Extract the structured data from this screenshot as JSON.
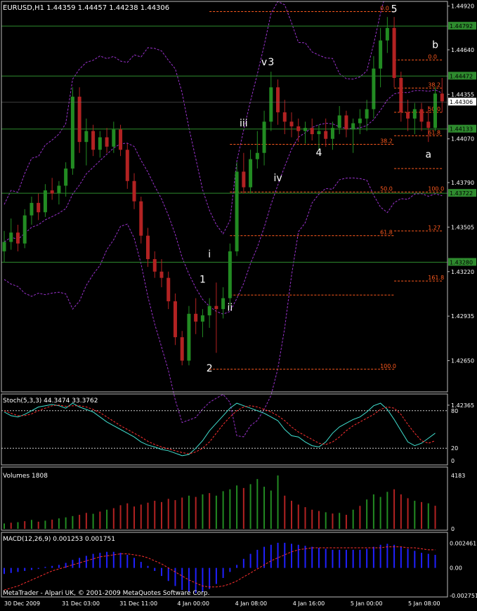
{
  "chart_data": {
    "type": "candlestick",
    "symbol_header": "EURUSD,H1  1.44359 1.44457 1.44238 1.44306",
    "footer": "MetaTrader - Alpari UK, © 2001-2009 MetaQuotes Software Corp.",
    "colors": {
      "background": "#000000",
      "bull": "#228b22",
      "bear": "#b22222",
      "bands": "#9932cc",
      "levels": "#ff5a1e",
      "hlines": "#2e8b2e",
      "axis_text": "#ffffff",
      "stoch_main": "#40e0d0",
      "stoch_signal": "#ff3030",
      "macd_hist": "#2020ff",
      "macd_signal": "#ff3030"
    },
    "time_labels": [
      "30 Dec 2009",
      "31 Dec 03:00",
      "31 Dec 11:00",
      "4 Jan 00:00",
      "4 Jan 08:00",
      "4 Jan 16:00",
      "5 Jan 00:00",
      "5 Jan 08:00"
    ],
    "main": {
      "ylim": [
        1.4245,
        1.4495
      ],
      "price_ticks": [
        "1.44920",
        "1.44640",
        "1.44355",
        "1.44070",
        "1.43790",
        "1.43505",
        "1.43220",
        "1.42935",
        "1.42650",
        "1.42365"
      ],
      "tick_values": [
        1.4492,
        1.4464,
        1.44355,
        1.4407,
        1.4379,
        1.43505,
        1.4322,
        1.42935,
        1.4265,
        1.42365
      ],
      "tick_labels": [
        "1.44920",
        "1.44640",
        "1.44355",
        "1.44070",
        "1.43790",
        "1.43505",
        "1.43220",
        "1.42935",
        "1.42650",
        "1.42365"
      ],
      "horizontal_lines": [
        {
          "value": 1.44792,
          "label": "1.44792"
        },
        {
          "value": 1.44472,
          "label": "1.44472"
        },
        {
          "value": 1.44133,
          "label": "1.44133"
        },
        {
          "value": 1.43722,
          "label": "1.43722"
        },
        {
          "value": 1.4328,
          "label": "1.43280"
        }
      ],
      "current_price": {
        "value": 1.44306,
        "label": "1.44306"
      },
      "ohlc": [
        [
          1.4335,
          1.4348,
          1.4328,
          1.4341
        ],
        [
          1.4341,
          1.4356,
          1.4336,
          1.4347
        ],
        [
          1.4347,
          1.4352,
          1.4335,
          1.434
        ],
        [
          1.434,
          1.4362,
          1.4337,
          1.4358
        ],
        [
          1.4358,
          1.437,
          1.4352,
          1.4366
        ],
        [
          1.4366,
          1.4372,
          1.4355,
          1.436
        ],
        [
          1.436,
          1.4378,
          1.4357,
          1.4374
        ],
        [
          1.4374,
          1.4382,
          1.4368,
          1.4372
        ],
        [
          1.4372,
          1.438,
          1.4365,
          1.4377
        ],
        [
          1.4377,
          1.4392,
          1.437,
          1.4388
        ],
        [
          1.4388,
          1.444,
          1.4384,
          1.4434
        ],
        [
          1.4434,
          1.444,
          1.4398,
          1.4405
        ],
        [
          1.4405,
          1.442,
          1.439,
          1.4412
        ],
        [
          1.4412,
          1.4416,
          1.4396,
          1.44
        ],
        [
          1.44,
          1.4412,
          1.4395,
          1.4408
        ],
        [
          1.4408,
          1.4414,
          1.4398,
          1.4402
        ],
        [
          1.4402,
          1.4418,
          1.4398,
          1.4413
        ],
        [
          1.4413,
          1.4416,
          1.4396,
          1.44
        ],
        [
          1.44,
          1.4404,
          1.4375,
          1.438
        ],
        [
          1.438,
          1.4385,
          1.4362,
          1.4367
        ],
        [
          1.4367,
          1.437,
          1.434,
          1.4345
        ],
        [
          1.4345,
          1.435,
          1.4325,
          1.433
        ],
        [
          1.433,
          1.4335,
          1.4318,
          1.4322
        ],
        [
          1.4322,
          1.433,
          1.4312,
          1.4318
        ],
        [
          1.4318,
          1.4322,
          1.4298,
          1.4303
        ],
        [
          1.4303,
          1.4308,
          1.4275,
          1.428
        ],
        [
          1.428,
          1.4284,
          1.4262,
          1.4265
        ],
        [
          1.4265,
          1.43,
          1.4262,
          1.4295
        ],
        [
          1.4295,
          1.4305,
          1.4282,
          1.429
        ],
        [
          1.429,
          1.4298,
          1.428,
          1.4294
        ],
        [
          1.4294,
          1.4305,
          1.4286,
          1.43
        ],
        [
          1.43,
          1.4315,
          1.427,
          1.4298
        ],
        [
          1.4298,
          1.4312,
          1.4292,
          1.4305
        ],
        [
          1.4305,
          1.434,
          1.43,
          1.4335
        ],
        [
          1.4335,
          1.4392,
          1.4332,
          1.4386
        ],
        [
          1.4386,
          1.4398,
          1.4372,
          1.4376
        ],
        [
          1.4376,
          1.44,
          1.4372,
          1.4394
        ],
        [
          1.4394,
          1.4412,
          1.4388,
          1.4398
        ],
        [
          1.4398,
          1.4425,
          1.439,
          1.4418
        ],
        [
          1.4418,
          1.445,
          1.4412,
          1.444
        ],
        [
          1.444,
          1.4445,
          1.4416,
          1.4424
        ],
        [
          1.4424,
          1.4432,
          1.441,
          1.4418
        ],
        [
          1.4418,
          1.4424,
          1.4408,
          1.4415
        ],
        [
          1.4415,
          1.442,
          1.4405,
          1.4412
        ],
        [
          1.4412,
          1.4418,
          1.4404,
          1.4414
        ],
        [
          1.4414,
          1.442,
          1.4406,
          1.441
        ],
        [
          1.441,
          1.4416,
          1.44,
          1.4412
        ],
        [
          1.4412,
          1.442,
          1.4402,
          1.4407
        ],
        [
          1.4407,
          1.4418,
          1.44,
          1.4414
        ],
        [
          1.4414,
          1.4428,
          1.441,
          1.4422
        ],
        [
          1.4422,
          1.4425,
          1.4408,
          1.4413
        ],
        [
          1.4413,
          1.442,
          1.4398,
          1.4417
        ],
        [
          1.4417,
          1.4426,
          1.441,
          1.442
        ],
        [
          1.442,
          1.4432,
          1.4412,
          1.4426
        ],
        [
          1.4426,
          1.446,
          1.442,
          1.4452
        ],
        [
          1.4452,
          1.4478,
          1.444,
          1.447
        ],
        [
          1.447,
          1.4485,
          1.4462,
          1.4478
        ],
        [
          1.4478,
          1.4485,
          1.444,
          1.4446
        ],
        [
          1.4446,
          1.445,
          1.4418,
          1.4424
        ],
        [
          1.4424,
          1.4432,
          1.4412,
          1.442
        ],
        [
          1.442,
          1.443,
          1.441,
          1.4426
        ],
        [
          1.4426,
          1.443,
          1.4412,
          1.4418
        ],
        [
          1.4418,
          1.4428,
          1.4405,
          1.4414
        ],
        [
          1.4414,
          1.444,
          1.4412,
          1.4436
        ],
        [
          1.4436,
          1.4446,
          1.4424,
          1.4431
        ]
      ],
      "wave_labels": [
        {
          "text": "1",
          "bar": 29,
          "value": 1.4315
        },
        {
          "text": "2",
          "bar": 30,
          "value": 1.4258
        },
        {
          "text": "3",
          "bar": 39,
          "value": 1.4454
        },
        {
          "text": "4",
          "bar": 46,
          "value": 1.4396
        },
        {
          "text": "5",
          "bar": 57,
          "value": 1.4488
        },
        {
          "text": "a",
          "bar": 62,
          "value": 1.4395
        },
        {
          "text": "b",
          "bar": 63,
          "value": 1.4465
        },
        {
          "text": "i",
          "bar": 30,
          "value": 1.4331
        },
        {
          "text": "ii",
          "bar": 33,
          "value": 1.4297
        },
        {
          "text": "iii",
          "bar": 35,
          "value": 1.4415
        },
        {
          "text": "iv",
          "bar": 40,
          "value": 1.438
        },
        {
          "text": "v",
          "bar": 38,
          "value": 1.4454
        }
      ],
      "fib_levels": [
        {
          "value": 1.44885,
          "label": "0.0",
          "from": 30,
          "to": 57
        },
        {
          "value": 1.44575,
          "label": "0.0",
          "from": 57,
          "to": 64
        },
        {
          "value": 1.44395,
          "label": "38.2",
          "from": 57,
          "to": 64
        },
        {
          "value": 1.4424,
          "label": "50.0",
          "from": 57,
          "to": 64
        },
        {
          "value": 1.4409,
          "label": "61.8",
          "from": 57,
          "to": 64
        },
        {
          "value": 1.44035,
          "label": "38.2",
          "from": 33,
          "to": 57
        },
        {
          "value": 1.4388,
          "label": "",
          "from": 57,
          "to": 64
        },
        {
          "value": 1.4373,
          "label": "50.0",
          "from": 33,
          "to": 57
        },
        {
          "value": 1.4373,
          "label": "100.0",
          "from": 57,
          "to": 64
        },
        {
          "value": 1.4348,
          "label": "1.27",
          "from": 57,
          "to": 64
        },
        {
          "value": 1.4345,
          "label": "61.8",
          "from": 33,
          "to": 57
        },
        {
          "value": 1.4307,
          "label": "",
          "from": 33,
          "to": 57
        },
        {
          "value": 1.4316,
          "label": "161.8",
          "from": 57,
          "to": 64
        },
        {
          "value": 1.42595,
          "label": "100.0",
          "from": 30,
          "to": 57
        }
      ]
    },
    "stoch": {
      "title": "Stoch(5,3,3) 44.3474 33.3762",
      "ylim": [
        0,
        100
      ],
      "tick_values": [
        80,
        20,
        0
      ],
      "tick_labels": [
        "80",
        "20",
        "0"
      ],
      "levels": [
        80,
        20
      ],
      "main_values": [
        78,
        72,
        70,
        74,
        80,
        86,
        88,
        90,
        88,
        84,
        92,
        86,
        82,
        78,
        70,
        62,
        56,
        50,
        44,
        38,
        30,
        25,
        22,
        18,
        16,
        12,
        8,
        10,
        20,
        32,
        48,
        60,
        72,
        84,
        92,
        88,
        84,
        80,
        76,
        70,
        64,
        50,
        40,
        38,
        30,
        24,
        22,
        30,
        44,
        54,
        60,
        66,
        70,
        78,
        88,
        92,
        82,
        66,
        48,
        30,
        24,
        28,
        36,
        44
      ],
      "signal_values": [
        80,
        76,
        72,
        72,
        75,
        80,
        84,
        88,
        89,
        87,
        88,
        88,
        86,
        82,
        77,
        70,
        63,
        56,
        50,
        44,
        38,
        31,
        26,
        22,
        19,
        16,
        13,
        11,
        14,
        20,
        30,
        44,
        58,
        70,
        80,
        86,
        88,
        86,
        82,
        78,
        72,
        64,
        54,
        46,
        40,
        34,
        28,
        26,
        30,
        38,
        48,
        56,
        62,
        68,
        74,
        82,
        86,
        84,
        74,
        58,
        44,
        32,
        28,
        32
      ]
    },
    "volumes": {
      "title": "Volumes 1808",
      "ylim": [
        0,
        4183
      ],
      "tick_values": [
        4183,
        0
      ],
      "tick_labels": [
        "4183",
        "0"
      ],
      "values": [
        420,
        480,
        520,
        600,
        700,
        560,
        640,
        720,
        820,
        900,
        1000,
        1100,
        1250,
        1180,
        1350,
        1500,
        1620,
        1850,
        2000,
        1750,
        1900,
        2050,
        2200,
        2100,
        2350,
        2250,
        2450,
        2600,
        2500,
        2700,
        2800,
        2600,
        2950,
        3100,
        3400,
        3200,
        3500,
        3900,
        3300,
        3000,
        4183,
        2600,
        2200,
        1900,
        1700,
        1500,
        1400,
        1300,
        1200,
        1250,
        1100,
        1500,
        1800,
        2300,
        2700,
        2500,
        2900,
        3100,
        2700,
        2400,
        2200,
        2100,
        2000,
        1808
      ],
      "up_flags": [
        1,
        0,
        1,
        0,
        1,
        0,
        1,
        0,
        1,
        1,
        1,
        0,
        0,
        1,
        0,
        1,
        0,
        0,
        0,
        0,
        0,
        0,
        0,
        0,
        0,
        0,
        0,
        1,
        0,
        1,
        0,
        1,
        1,
        1,
        1,
        0,
        1,
        1,
        1,
        1,
        1,
        0,
        0,
        0,
        0,
        0,
        0,
        1,
        0,
        1,
        0,
        1,
        0,
        1,
        1,
        1,
        1,
        0,
        0,
        0,
        1,
        0,
        1,
        0
      ]
    },
    "macd": {
      "title": "MACD(12,26,9) 0.001253 0.001751",
      "ylim": [
        -0.00275,
        0.0027
      ],
      "tick_values": [
        0.002461,
        0.0,
        -0.002751
      ],
      "tick_labels": [
        "0.002461",
        "0.00",
        "-0.002751"
      ],
      "hist_values": [
        -0.0006,
        -0.0005,
        -0.0004,
        -0.0003,
        -0.0002,
        -0.0001,
        0.0001,
        0.0002,
        0.0003,
        0.0005,
        0.0008,
        0.001,
        0.0012,
        0.0014,
        0.0015,
        0.0016,
        0.0016,
        0.0015,
        0.0013,
        0.001,
        0.0006,
        0.0002,
        -0.0003,
        -0.0008,
        -0.0013,
        -0.0018,
        -0.0022,
        -0.0024,
        -0.0025,
        -0.0024,
        -0.0021,
        -0.0016,
        -0.001,
        -0.0004,
        0.0003,
        0.0009,
        0.0014,
        0.0018,
        0.0021,
        0.0023,
        0.0025,
        0.0025,
        0.0024,
        0.0023,
        0.0022,
        0.0021,
        0.002,
        0.0019,
        0.0018,
        0.0018,
        0.0018,
        0.0018,
        0.0018,
        0.0019,
        0.0021,
        0.0023,
        0.0024,
        0.0023,
        0.0021,
        0.0019,
        0.0017,
        0.0015,
        0.0014,
        0.0013
      ],
      "signal_values": [
        -0.0022,
        -0.002,
        -0.0018,
        -0.0015,
        -0.0012,
        -0.0009,
        -0.0006,
        -0.0003,
        -0.0001,
        0.0001,
        0.0003,
        0.0005,
        0.0007,
        0.0009,
        0.0011,
        0.0012,
        0.0013,
        0.0014,
        0.0014,
        0.0013,
        0.0012,
        0.001,
        0.0007,
        0.0004,
        0.0,
        -0.0004,
        -0.0008,
        -0.0012,
        -0.0015,
        -0.0018,
        -0.0019,
        -0.0019,
        -0.0018,
        -0.0016,
        -0.0013,
        -0.0009,
        -0.0005,
        -0.0001,
        0.0003,
        0.0007,
        0.001,
        0.0013,
        0.0016,
        0.0018,
        0.0019,
        0.002,
        0.002,
        0.002,
        0.002,
        0.002,
        0.002,
        0.002,
        0.002,
        0.002,
        0.002,
        0.002,
        0.0021,
        0.0021,
        0.0021,
        0.002,
        0.002,
        0.0019,
        0.0018,
        0.0018
      ]
    }
  }
}
